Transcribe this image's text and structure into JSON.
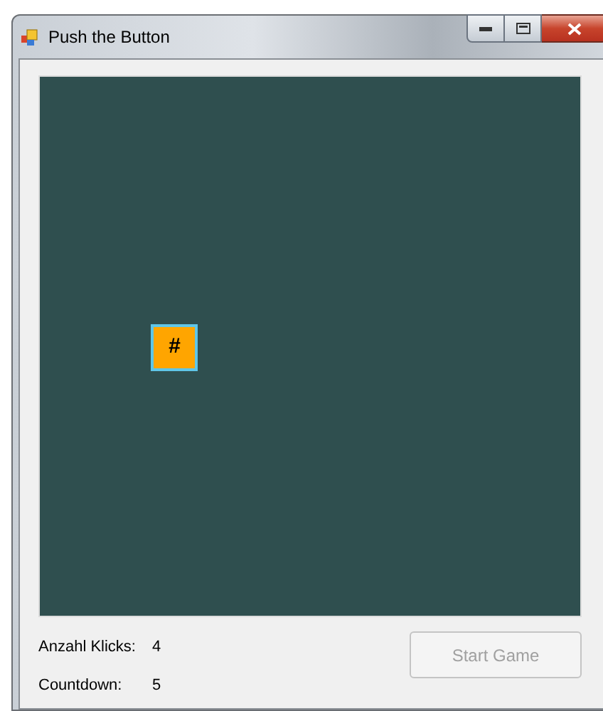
{
  "window": {
    "title": "Push the Button"
  },
  "game_button": {
    "label": "#"
  },
  "stats": [
    {
      "label": "Anzahl Klicks:",
      "value": "4"
    },
    {
      "label": "Countdown:",
      "value": "5"
    }
  ],
  "start_button": {
    "label": "Start Game",
    "disabled": true
  }
}
